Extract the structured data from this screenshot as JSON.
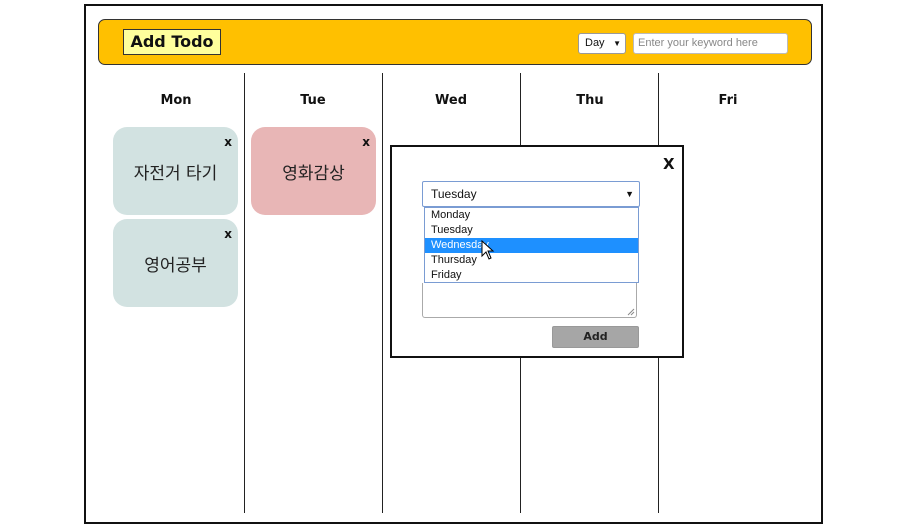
{
  "header": {
    "add_todo_label": "Add Todo",
    "view_select_value": "Day",
    "search_placeholder": "Enter your keyword here",
    "background_color": "#ffc000"
  },
  "days": [
    "Mon",
    "Tue",
    "Wed",
    "Thu",
    "Fri"
  ],
  "todos": {
    "mon": [
      {
        "title": "자전거 타기",
        "close": "x",
        "color": "#d2e2e1"
      },
      {
        "title": "영어공부",
        "close": "x",
        "color": "#d2e2e1"
      }
    ],
    "tue": [
      {
        "title": "영화감상",
        "close": "x",
        "color": "#e8b6b6"
      }
    ]
  },
  "modal": {
    "close_label": "X",
    "day_select_value": "Tuesday",
    "day_options": [
      "Monday",
      "Tuesday",
      "Wednesday",
      "Thursday",
      "Friday"
    ],
    "highlighted_option": "Wednesday",
    "add_button_label": "Add"
  }
}
